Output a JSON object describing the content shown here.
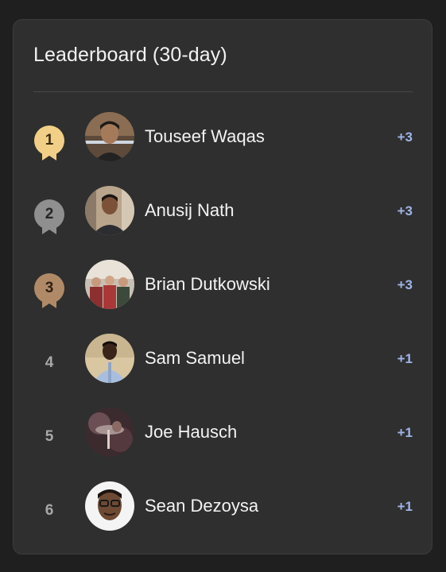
{
  "leaderboard": {
    "title": "Leaderboard (30-day)",
    "colors": {
      "gold": "#f2cf86",
      "silver": "#8f8f8f",
      "bronze": "#b08a67",
      "score": "#9fb4e8"
    },
    "entries": [
      {
        "rank": "1",
        "name": "Touseef Waqas",
        "score": "+3",
        "medal": "gold"
      },
      {
        "rank": "2",
        "name": "Anusij Nath",
        "score": "+3",
        "medal": "silver"
      },
      {
        "rank": "3",
        "name": "Brian Dutkowski",
        "score": "+3",
        "medal": "bronze"
      },
      {
        "rank": "4",
        "name": "Sam Samuel",
        "score": "+1",
        "medal": ""
      },
      {
        "rank": "5",
        "name": "Joe Hausch",
        "score": "+1",
        "medal": ""
      },
      {
        "rank": "6",
        "name": "Sean Dezoysa",
        "score": "+1",
        "medal": ""
      }
    ]
  }
}
